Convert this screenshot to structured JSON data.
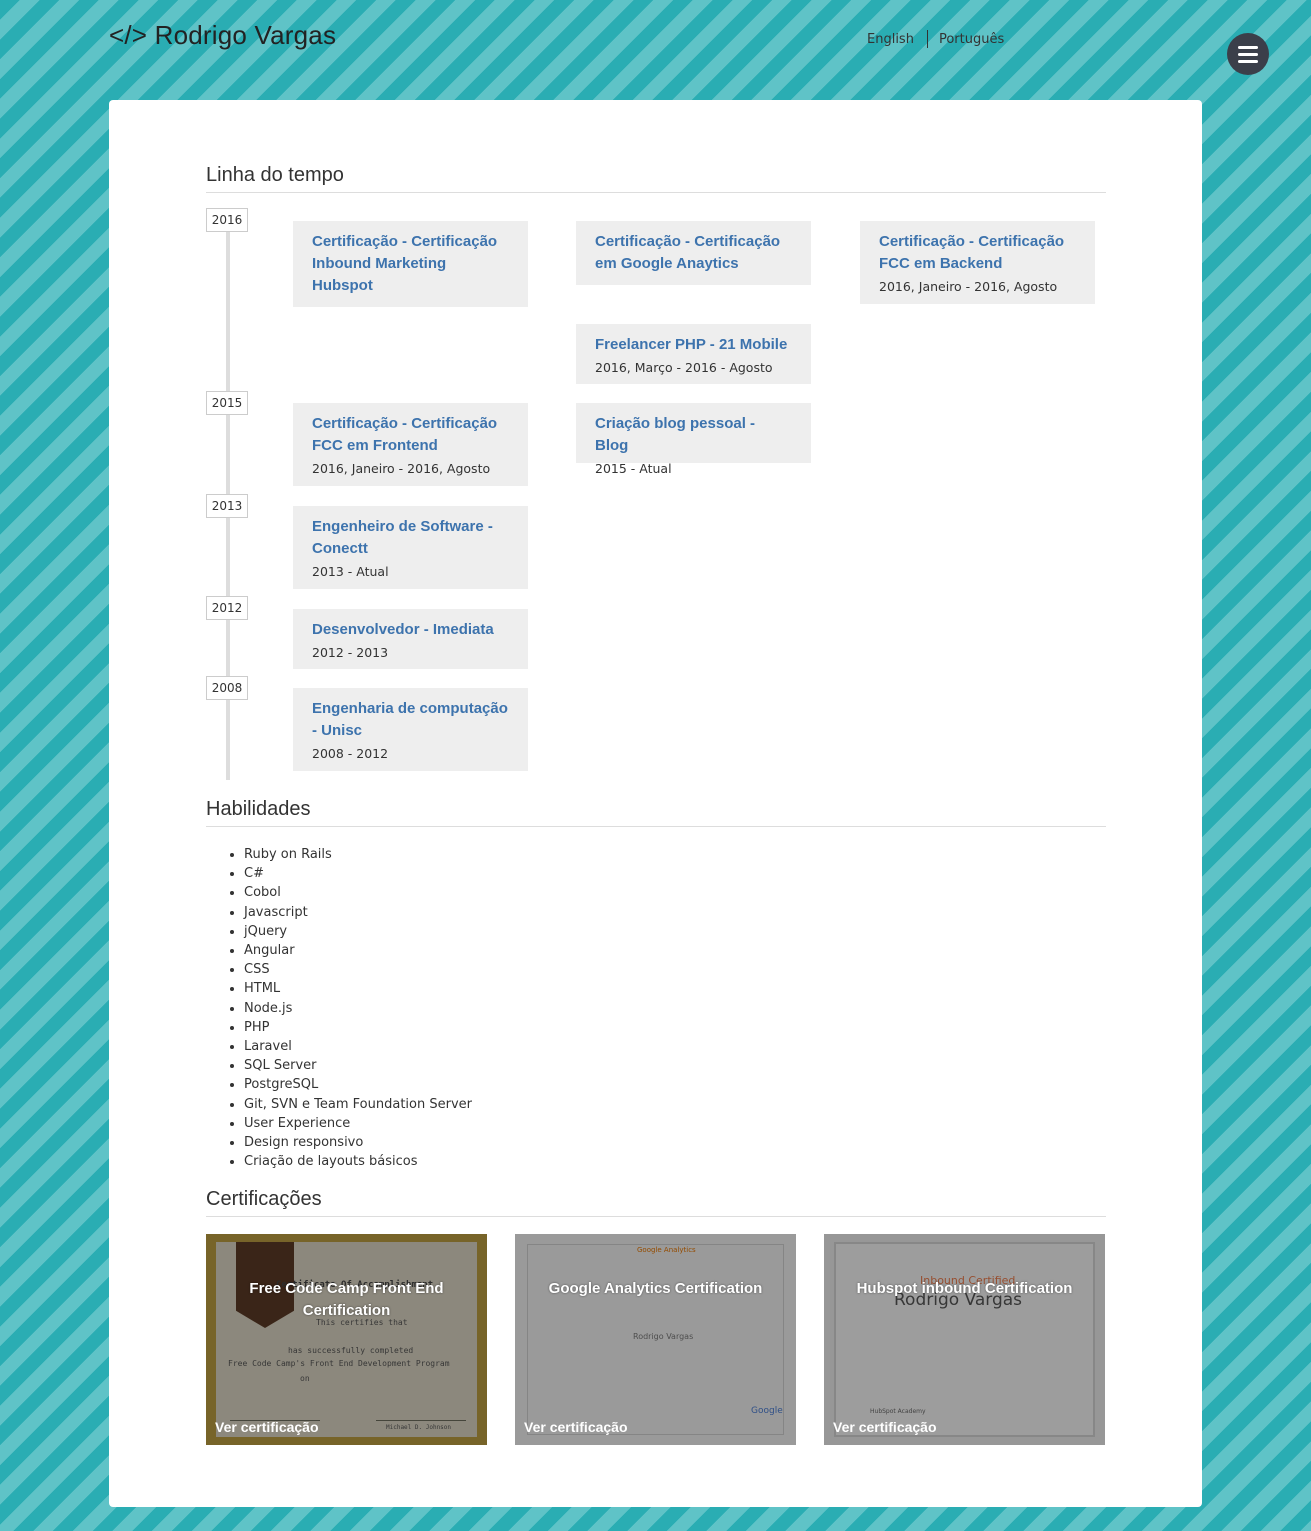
{
  "header": {
    "logo": "</> Rodrigo Vargas",
    "lang_english": "English",
    "lang_portuguese": "Português",
    "menu_icon": "hamburger-icon"
  },
  "timeline": {
    "title": "Linha do tempo",
    "years": [
      "2016",
      "2015",
      "2013",
      "2012",
      "2008"
    ],
    "items": [
      {
        "title": "Certificação - Certificação Inbound Marketing Hubspot",
        "date": ""
      },
      {
        "title": "Certificação - Certificação em Google Anaytics",
        "date": ""
      },
      {
        "title": "Certificação - Certificação FCC em Backend",
        "date": "2016, Janeiro - 2016, Agosto"
      },
      {
        "title": "Freelancer PHP - 21 Mobile",
        "date": "2016, Março - 2016 - Agosto"
      },
      {
        "title": "Certificação - Certificação FCC em Frontend",
        "date": "2016, Janeiro - 2016, Agosto"
      },
      {
        "title": "Criação blog pessoal - Blog",
        "date": "2015 - Atual"
      },
      {
        "title": "Engenheiro de Software - Conectt",
        "date": "2013 - Atual"
      },
      {
        "title": "Desenvolvedor - Imediata",
        "date": "2012 - 2013"
      },
      {
        "title": "Engenharia de computação - Unisc",
        "date": "2008 - 2012"
      }
    ]
  },
  "skills": {
    "title": "Habilidades",
    "items": [
      "Ruby on Rails",
      "C#",
      "Cobol",
      "Javascript",
      "jQuery",
      "Angular",
      "CSS",
      "HTML",
      "Node.js",
      "PHP",
      "Laravel",
      "SQL Server",
      "PostgreSQL",
      "Git, SVN e Team Foundation Server",
      "User Experience",
      "Design responsivo",
      "Criação de layouts básicos"
    ]
  },
  "certifications": {
    "title": "Certificações",
    "link_label": "Ver certificação",
    "items": [
      {
        "title": "Free Code Camp Front End Certification",
        "image_text": [
          "Certificate Of Accomplishment",
          "This certifies that",
          "has successfully completed",
          "Free Code Camp's Front End Development Program",
          "on",
          "Michael D. Johnson"
        ]
      },
      {
        "title": "Google Analytics Certification",
        "image_text": [
          "Google Analytics",
          "Rodrigo Vargas",
          "Google"
        ]
      },
      {
        "title": "Hubspot inbound Certification",
        "image_text": [
          "Inbound Certified",
          "Rodrigo Vargas",
          "HubSpot Academy"
        ]
      }
    ]
  }
}
